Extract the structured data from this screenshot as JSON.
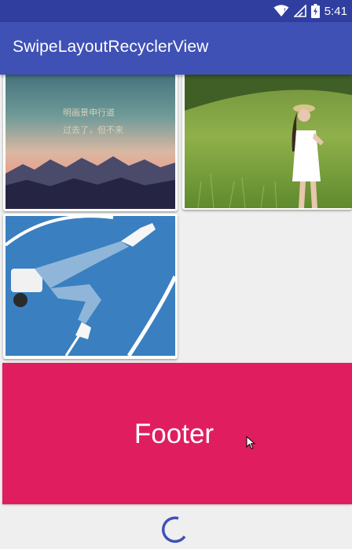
{
  "status_bar": {
    "time": "5:41",
    "icons": [
      "wifi-icon",
      "signal-icon",
      "battery-icon"
    ]
  },
  "app_bar": {
    "title": "SwipeLayoutRecyclerView"
  },
  "grid": {
    "items": [
      {
        "image": "sunset-mountains-image",
        "caption_line_1": "明画景申行道",
        "caption_line_2": "过去了，但不来"
      },
      {
        "image": "girl-in-grass-field-image"
      },
      {
        "image": "person-lying-on-court-image"
      }
    ]
  },
  "footer": {
    "label": "Footer",
    "color": "#e01e5f"
  },
  "loading": {
    "indicator": "loading-spinner"
  },
  "colors": {
    "status_bar": "#303f9f",
    "app_bar": "#3f51b5",
    "background": "#efefef",
    "spinner": "#3f51b5"
  }
}
